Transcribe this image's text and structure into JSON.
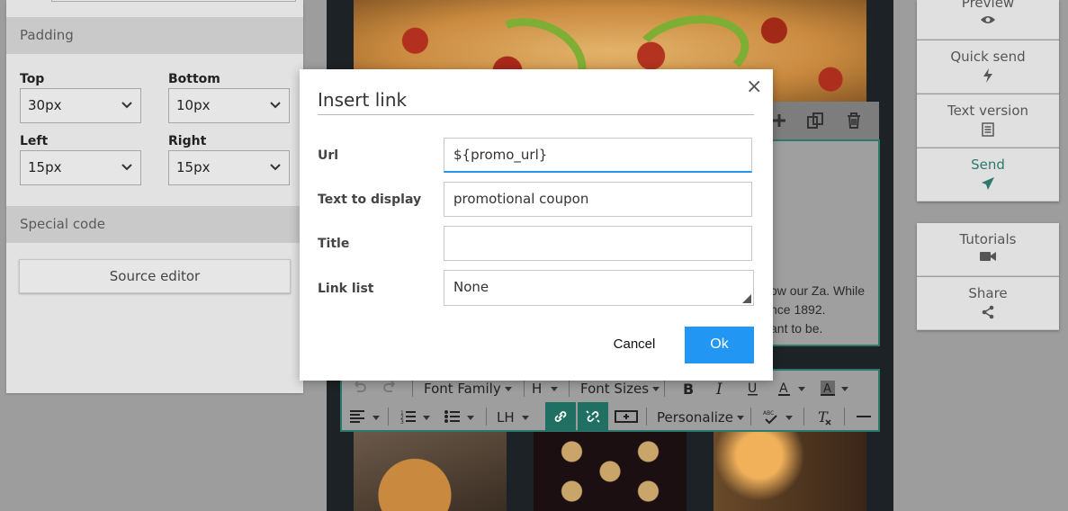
{
  "left_panel": {
    "padding_section": "Padding",
    "top_label": "Top",
    "top_value": "30px",
    "bottom_label": "Bottom",
    "bottom_value": "10px",
    "left_label": "Left",
    "left_value": "15px",
    "right_label": "Right",
    "right_value": "15px",
    "special_code_section": "Special code",
    "source_editor_button": "Source editor"
  },
  "canvas": {
    "text_lines": [
      "ow our Za. While",
      "nce 1892.",
      "ant to be."
    ]
  },
  "editor_toolbar": {
    "font_family": "Font Family",
    "heading": "H",
    "font_sizes": "Font Sizes",
    "line_height": "LH",
    "personalize": "Personalize",
    "icons": [
      "undo-icon",
      "redo-icon",
      "bold-icon",
      "italic-icon",
      "underline-icon",
      "text-color-icon",
      "background-color-icon",
      "align-icon",
      "numbered-list-icon",
      "bullet-list-icon",
      "link-icon",
      "unlink-icon",
      "insert-button-icon",
      "spellcheck-icon",
      "clear-format-icon",
      "horizontal-rule-icon"
    ]
  },
  "right_sidebar": {
    "preview": "Preview",
    "quick_send": "Quick send",
    "text_version": "Text version",
    "send": "Send",
    "tutorials": "Tutorials",
    "share": "Share"
  },
  "dialog": {
    "title": "Insert link",
    "close_glyph": "×",
    "url_label": "Url",
    "url_value": "${promo_url}",
    "text_label": "Text to display",
    "text_value": "promotional coupon",
    "title_label": "Title",
    "title_value": "",
    "link_list_label": "Link list",
    "link_list_value": "None",
    "cancel": "Cancel",
    "ok": "Ok"
  },
  "colors": {
    "accent_teal": "#2b7a6c",
    "primary_blue": "#2196f3",
    "overlay_gray": "#9d9d9d"
  }
}
